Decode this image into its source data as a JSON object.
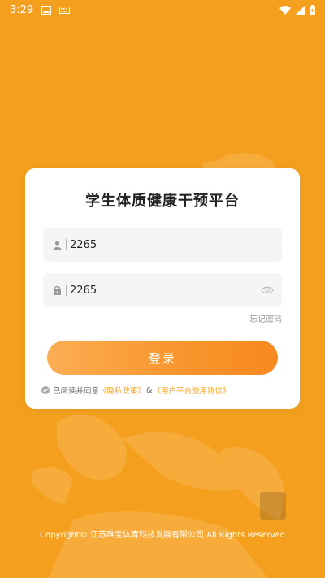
{
  "status_bar": {
    "time": "3:29"
  },
  "login": {
    "title": "学生体质健康干预平台",
    "username_value": "2265",
    "password_value": "2265",
    "forgot_label": "忘记密码",
    "login_button_label": "登录",
    "agreement_prefix": "已阅读并同意",
    "privacy_link": "《隐私政策》",
    "ampersand": "&",
    "terms_link": "《用户平台使用协议》"
  },
  "footer": {
    "copyright": "Copyright© 江苏唯宝体育科技发展有限公司 All Rights Reserved"
  },
  "colors": {
    "background": "#F4A01E",
    "accent": "#F7891F",
    "link": "#F4A01E"
  }
}
